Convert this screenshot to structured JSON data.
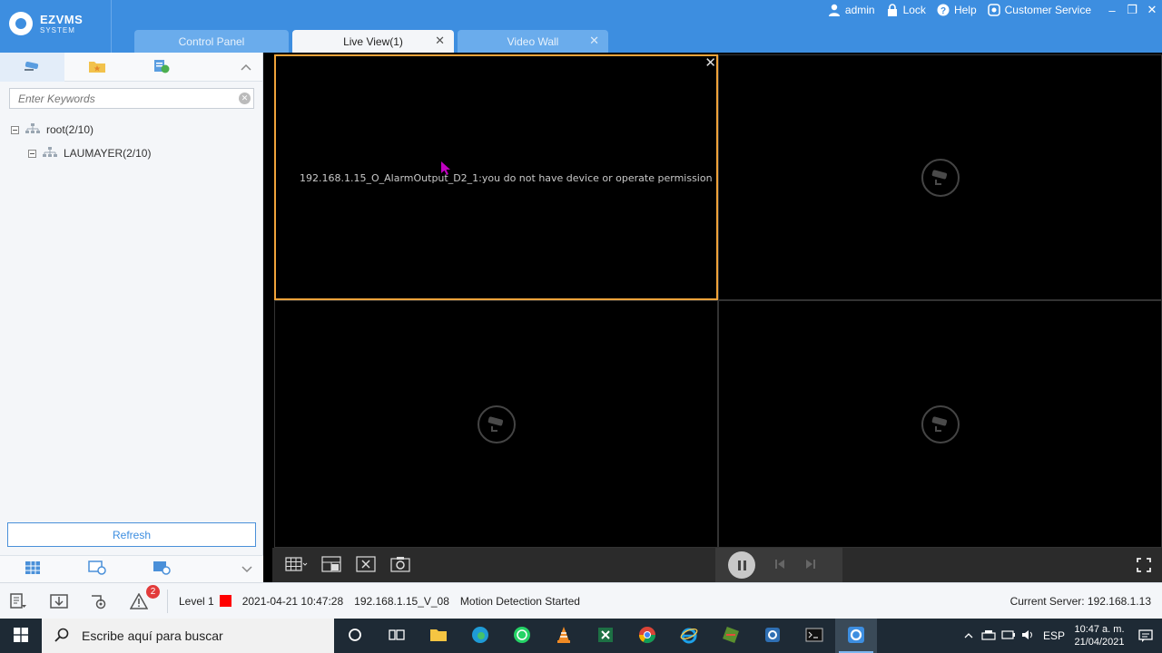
{
  "app": {
    "brand_title": "EZVMS",
    "brand_subtitle": "SYSTEM",
    "accent_color": "#3d8ee0",
    "selected_border_color": "#f0a33a"
  },
  "tabs": [
    {
      "label": "Control Panel",
      "closable": false
    },
    {
      "label": "Live View(1)",
      "closable": true,
      "active": true
    },
    {
      "label": "Video Wall",
      "closable": true
    }
  ],
  "top_right": {
    "user": "admin",
    "lock": "Lock",
    "help": "Help",
    "customer_service": "Customer Service",
    "minimize": "–",
    "restore": "❐",
    "close": "✕"
  },
  "left_panel": {
    "tab_icons": [
      "camera-icon",
      "favorites-folder-icon",
      "schedule-icon"
    ],
    "search_placeholder": "Enter Keywords",
    "tree": [
      {
        "label": "root(2/10)",
        "level": 0
      },
      {
        "label": "LAUMAYER(2/10)",
        "level": 1
      }
    ],
    "refresh_label": "Refresh",
    "bottom_icons": [
      "layout-icon",
      "view-refresh-icon",
      "group-refresh-icon"
    ]
  },
  "video": {
    "cell1_message": "192.168.1.15_O_AlarmOutput_D2_1:you do not have device or operate permission",
    "cell_close": "✕"
  },
  "status": {
    "alarm_count": "2",
    "level": "Level 1",
    "level_color": "#ff0000",
    "timestamp": "2021-04-21 10:47:28",
    "source": "192.168.1.15_V_08",
    "event": "Motion Detection Started",
    "current_server": "Current Server: 192.168.1.13"
  },
  "taskbar": {
    "search_placeholder": "Escribe aquí para buscar",
    "language": "ESP",
    "time": "10:47 a. m.",
    "date": "21/04/2021"
  }
}
